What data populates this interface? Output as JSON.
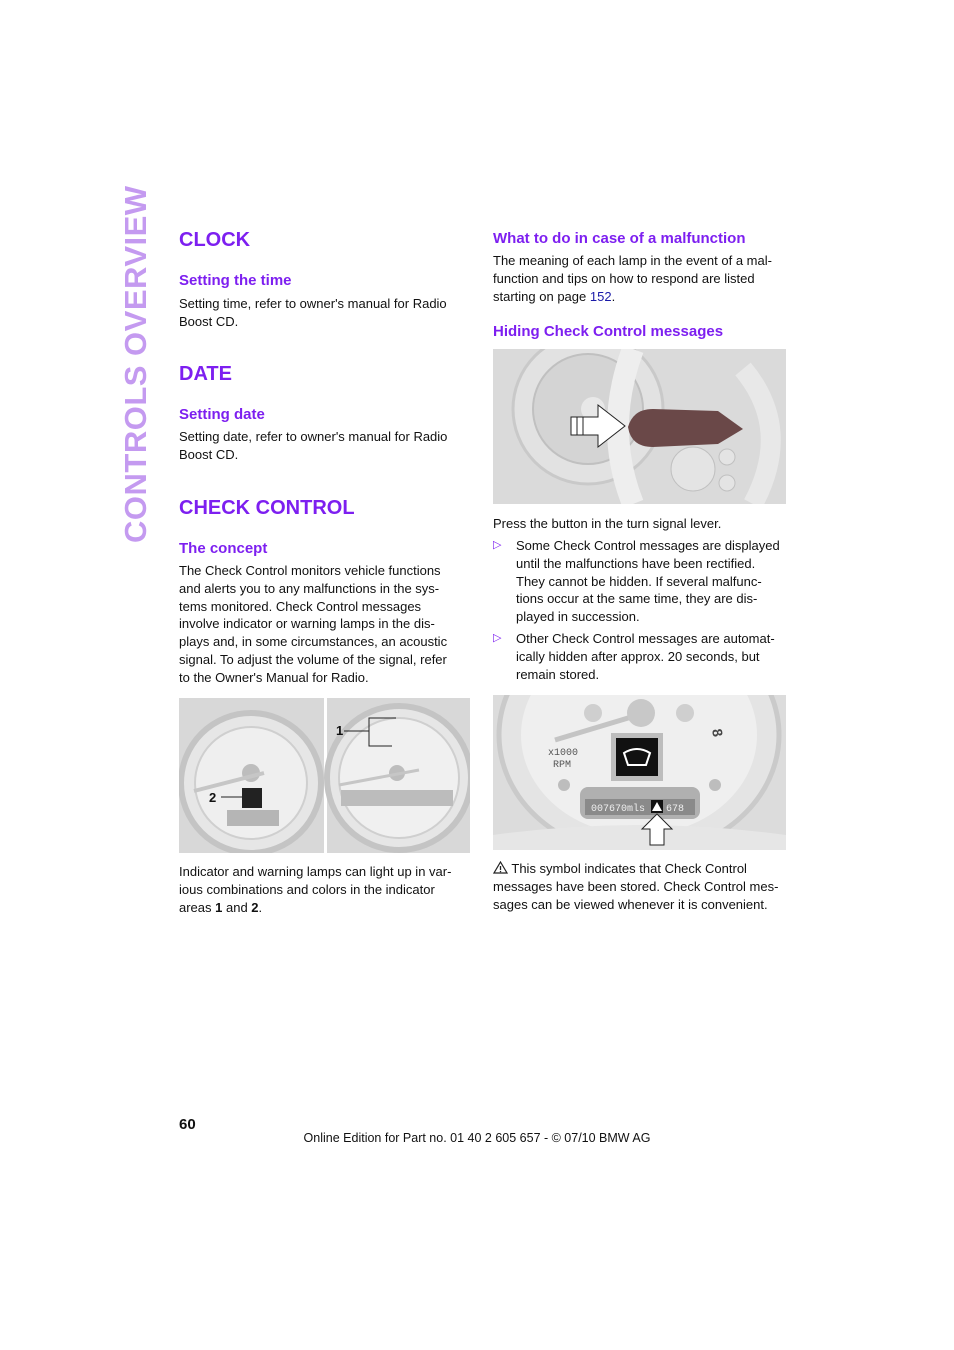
{
  "sidebar_title": "CONTROLS OVERVIEW",
  "left": {
    "clock_heading": "CLOCK",
    "setting_time_heading": "Setting the time",
    "setting_time_text": [
      "Setting time, refer to owner's manual for Radio",
      "Boost CD."
    ],
    "date_heading": "DATE",
    "setting_date_heading": "Setting date",
    "setting_date_text": [
      "Setting date, refer to owner's manual for Radio",
      "Boost CD."
    ],
    "check_control_heading": "CHECK CONTROL",
    "concept_heading": "The concept",
    "concept_text": [
      "The Check Control monitors vehicle functions",
      "and alerts you to any malfunctions in the sys-",
      "tems monitored. Check Control messages",
      "involve indicator or warning lamps in the dis-",
      "plays and, in some circumstances, an acoustic",
      "signal. To adjust the volume of the signal, refer",
      "to the Owner's Manual for Radio."
    ],
    "figure_labels": {
      "area1": "1",
      "area2": "2"
    },
    "caption_lines": [
      "Indicator and warning lamps can light up in var-",
      "ious combinations and colors in the indicator"
    ],
    "caption_last": {
      "pre": "areas ",
      "b1": "1",
      "mid": " and ",
      "b2": "2",
      "post": "."
    }
  },
  "right": {
    "malfunction_heading": "What to do in case of a malfunction",
    "malfunction_text": [
      "The meaning of each lamp in the event of a mal-",
      "function and tips on how to respond are listed"
    ],
    "malfunction_last": {
      "pre": "starting on page ",
      "page": "152",
      "post": "."
    },
    "hiding_heading": "Hiding Check Control messages",
    "press_text": "Press the button in the turn signal lever.",
    "bullets": [
      [
        "Some Check Control messages are displayed",
        "until the malfunctions have been rectified.",
        "They cannot be hidden. If several malfunc-",
        "tions occur at the same time, they are dis-",
        "played in succession."
      ],
      [
        "Other Check Control messages are automat-",
        "ically hidden after approx. 20 seconds, but",
        "remain stored."
      ]
    ],
    "display": {
      "rpm_label_1": "x1000",
      "rpm_label_2": "RPM",
      "odometer": "007670mls",
      "range": "678",
      "gauge_8": "8"
    },
    "symbol_text": [
      "This symbol indicates that Check Control",
      "messages have been stored. Check Control mes-",
      "sages can be viewed whenever it is convenient."
    ]
  },
  "footer": {
    "page_number": "60",
    "edition": "Online Edition for Part no. 01 40 2 605 657 - © 07/10  BMW AG"
  },
  "colors": {
    "heading": "#7d1ff0",
    "sidebar": "#c49af0",
    "link": "#1a1aa8"
  }
}
